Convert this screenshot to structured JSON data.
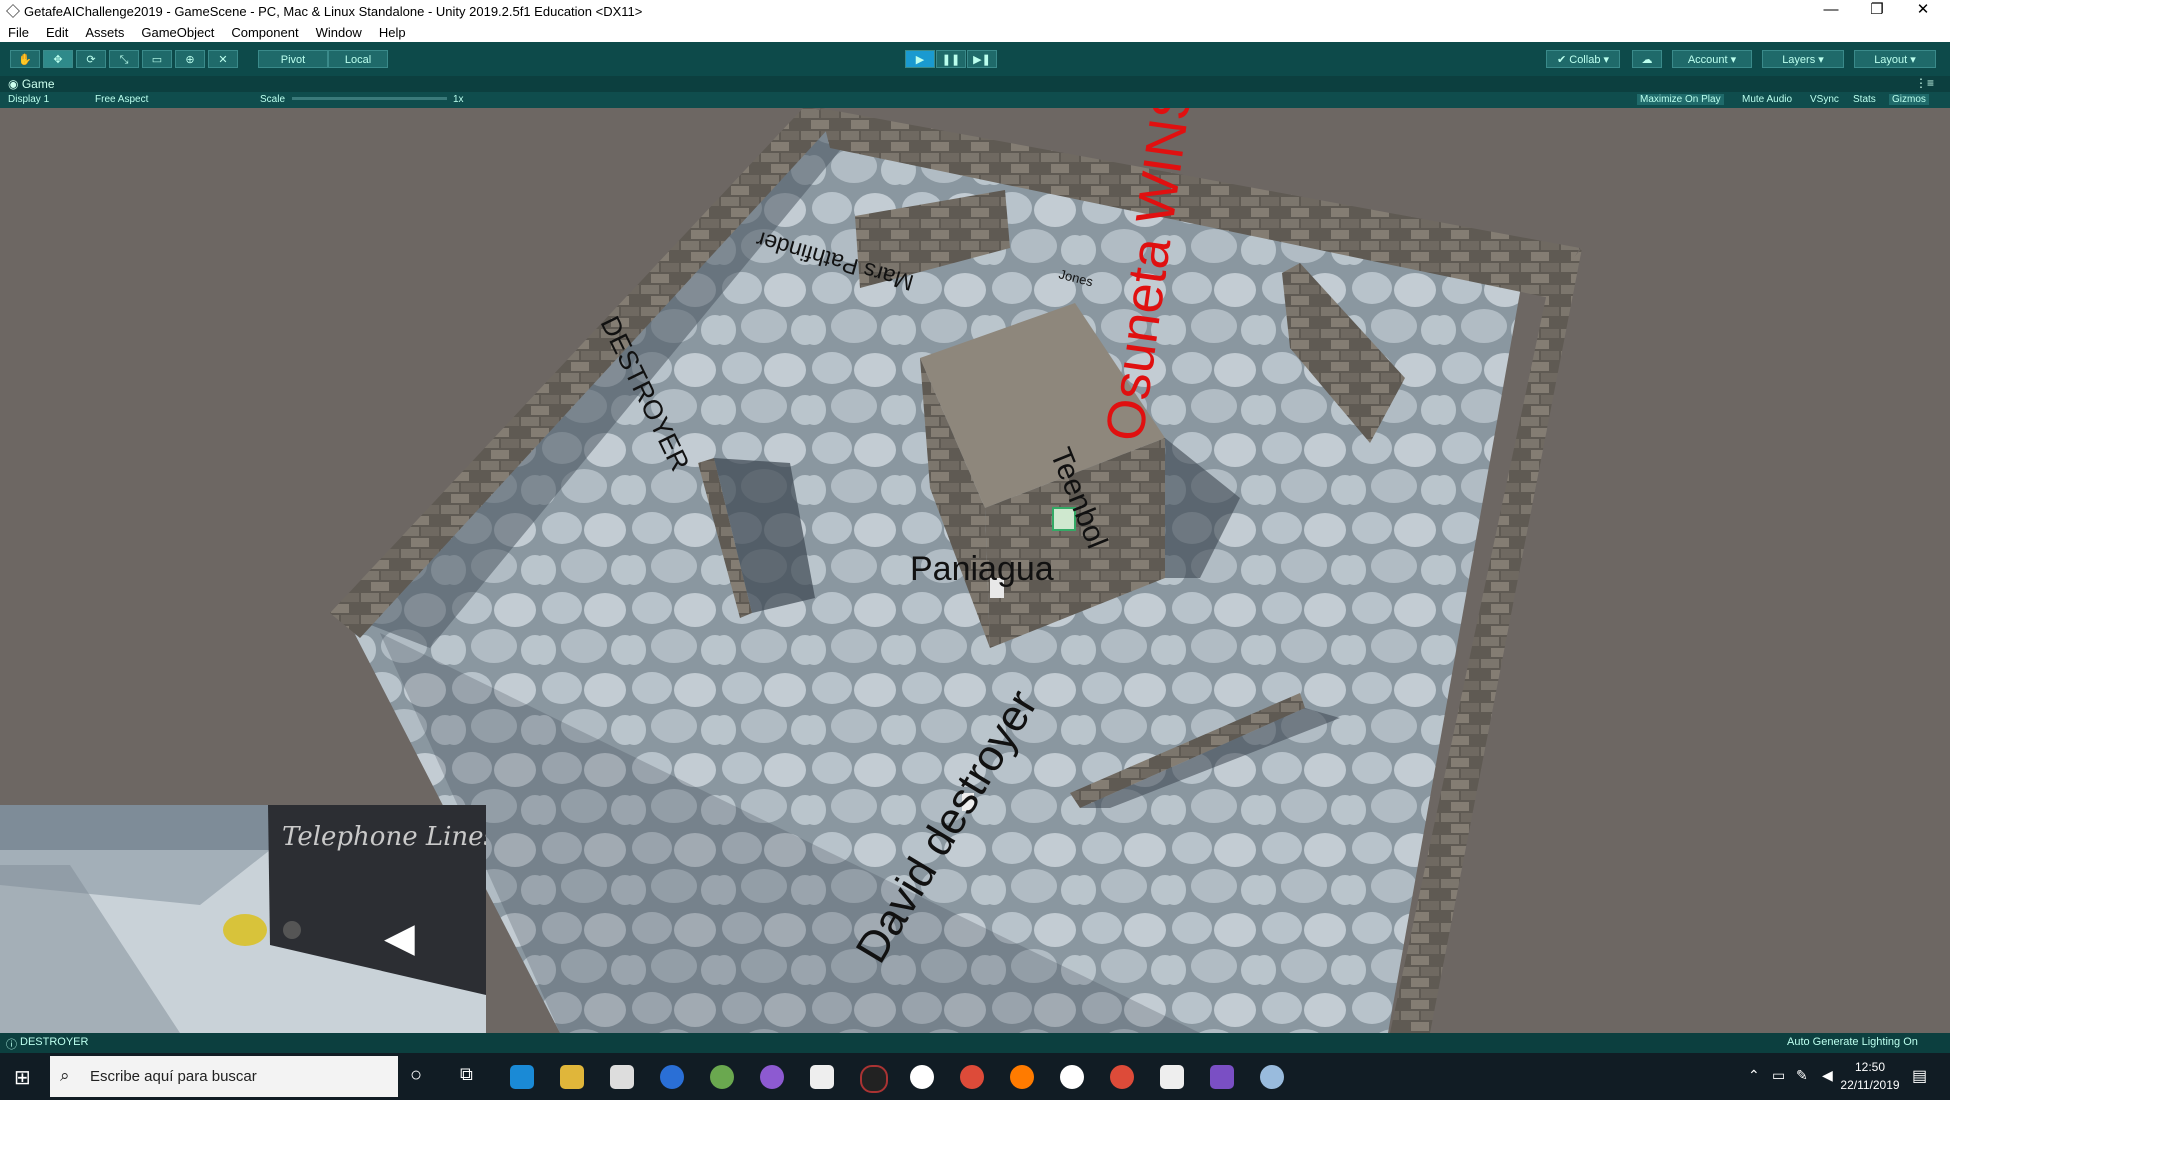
{
  "window": {
    "title": "GetafeAIChallenge2019 - GameScene - PC, Mac & Linux Standalone - Unity 2019.2.5f1 Education <DX11>",
    "controls": [
      "—",
      "❐",
      "✕"
    ]
  },
  "menu": [
    "File",
    "Edit",
    "Assets",
    "GameObject",
    "Component",
    "Window",
    "Help"
  ],
  "toolbar": {
    "pivot_label": "Pivot",
    "local_label": "Local",
    "collab_label": "Collab",
    "account_label": "Account",
    "layers_label": "Layers",
    "layout_label": "Layout",
    "play_state": "playing"
  },
  "game_tab": {
    "title": "Game",
    "display": "Display 1",
    "aspect": "Free Aspect",
    "scale_label": "Scale",
    "scale_value": "1x",
    "options": [
      "Maximize On Play",
      "Mute Audio",
      "VSync",
      "Stats",
      "Gizmos"
    ]
  },
  "scene_labels": {
    "winner": "Osuneta WINS",
    "mars": "Mars Pathfinder",
    "destroyer": "DESTROYER",
    "jones": "Jones",
    "teenbol": "Teenbol",
    "paniagua": "Paniagua",
    "david": "David destroyer"
  },
  "inset": {
    "graffiti": "Telephone Lines",
    "audio_icon": "speaker-icon"
  },
  "status": {
    "left": "DESTROYER",
    "right": "Auto Generate Lighting On"
  },
  "taskbar": {
    "search_placeholder": "Escribe aquí para buscar",
    "time": "12:50",
    "date": "22/11/2019"
  },
  "colors": {
    "toolbar": "#0d4a4a",
    "winner_text": "#e01010",
    "game_bg": "#6d6763"
  }
}
